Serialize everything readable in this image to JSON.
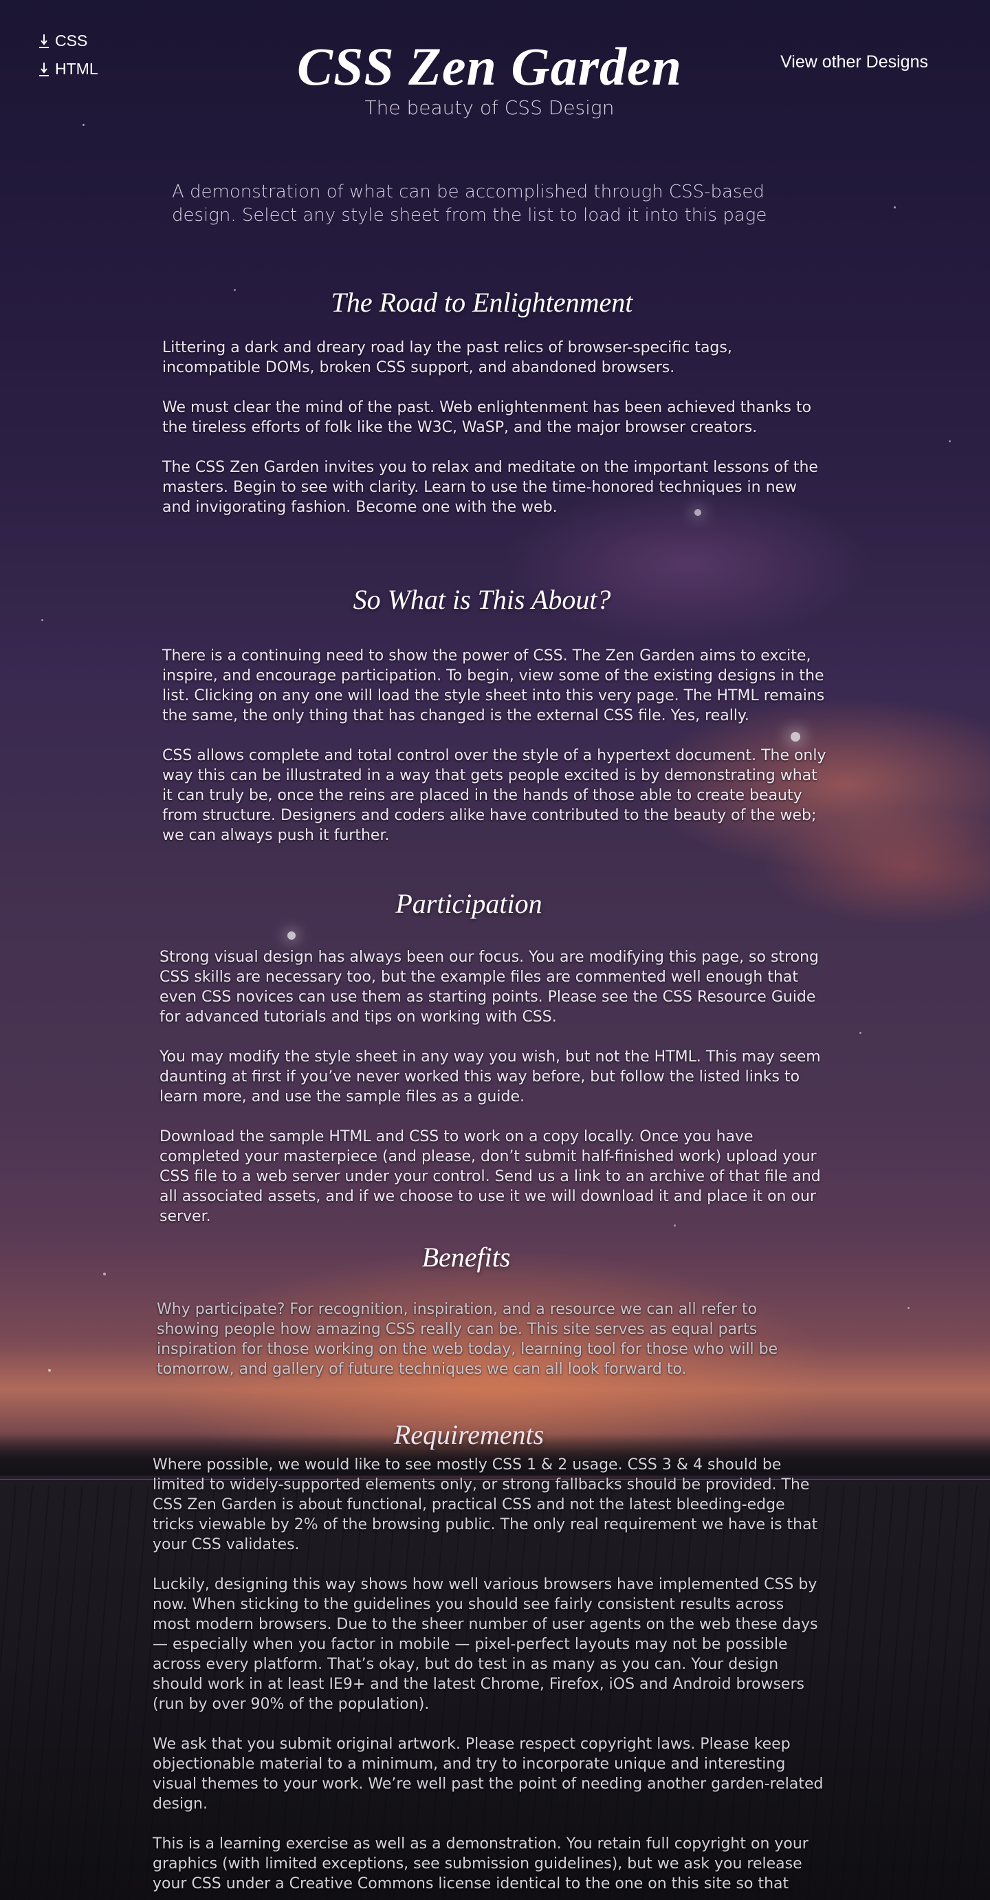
{
  "nav": {
    "css_label": "CSS",
    "html_label": "HTML",
    "view_other": "View other Designs"
  },
  "header": {
    "title": "CSS Zen Garden",
    "subtitle": "The beauty of CSS Design"
  },
  "summary": "A demonstration of what can be accomplished through CSS-based design.  Select any style sheet from the list to load it into this page",
  "sections": {
    "road": {
      "heading": "The Road to Enlightenment",
      "p1": "Littering a dark and dreary road lay the past relics of browser-specific tags, incompatible DOMs, broken CSS support, and abandoned browsers.",
      "p2": "We must clear the mind of the past. Web enlightenment has been achieved thanks to the tireless efforts of folk like the W3C, WaSP, and the major browser creators.",
      "p3": "The CSS Zen Garden invites you to relax and meditate on the important lessons of the masters. Begin to see with clarity. Learn to use the time-honored techniques in new and invigorating fashion. Become one with the web."
    },
    "about": {
      "heading": "So What is This About?",
      "p1": "There is a continuing need to show the power of CSS. The Zen Garden aims to excite, inspire, and encourage participation. To begin, view some of the existing designs in the list. Clicking on any one will load the style sheet into this very page. The HTML remains the same, the only thing that has changed is the external CSS file. Yes, really.",
      "p2": "CSS allows complete and total control over the style of a hypertext document. The only way this can be illustrated in a way that gets people excited is by demonstrating what it can truly be, once the reins are placed in the hands of those able to create beauty from structure. Designers and coders alike have contributed to the beauty of the web; we can always push it further."
    },
    "participation": {
      "heading": "Participation",
      "p1": "Strong visual design has always been our focus. You are modifying this page, so strong CSS skills are necessary too, but the example files are commented well enough that even CSS novices can use them as starting points. Please see the CSS Resource Guide for advanced tutorials and tips on working with CSS.",
      "p2": "You may modify the style sheet in any way you wish, but not the HTML. This may seem daunting at first if you’ve never worked this way before, but follow the listed links to learn more, and use the sample files as a guide.",
      "p3": "Download the sample HTML and CSS to work on a copy locally. Once you have completed your masterpiece (and please, don’t submit half-finished work) upload your CSS file to a web server under your control. Send us a link to an archive of that file and all associated assets, and if we choose to use it we will download it and place it on our server."
    },
    "benefits": {
      "heading": "Benefits",
      "p1": "Why participate? For recognition, inspiration, and a resource we can all refer to showing people how amazing CSS really can be. This site serves as equal parts inspiration for those working on the web today, learning tool for those who will be tomorrow, and gallery of future techniques we can all look forward to."
    },
    "requirements": {
      "heading": "Requirements",
      "p1": "Where possible, we would like to see mostly CSS 1 & 2 usage. CSS 3 & 4 should be limited to widely-supported elements only, or strong fallbacks should be provided. The CSS Zen Garden is about functional, practical CSS and not the latest bleeding-edge tricks viewable by 2% of the browsing public. The only real requirement we have is that your CSS validates.",
      "p2": "Luckily, designing this way shows how well various browsers have implemented CSS by now. When sticking to the guidelines you should see fairly consistent results across most modern browsers. Due to the sheer number of user agents on the web these days — especially when you factor in mobile — pixel-perfect layouts may not be possible across every platform. That’s okay, but do test in as many as you can. Your design should work in at least IE9+ and the latest Chrome, Firefox, iOS and Android browsers (run by over 90% of the population).",
      "p3": "We ask that you submit original artwork. Please respect copyright laws. Please keep objectionable material to a minimum, and try to incorporate unique and interesting visual themes to your work. We’re well past the point of needing another garden-related design.",
      "p4": "This is a learning exercise as well as a demonstration. You retain full copyright on your graphics (with limited exceptions, see submission guidelines), but we ask you release your CSS under a Creative Commons license identical to the one on this site so that"
    }
  },
  "icons": {
    "css_download": "download-icon",
    "html_download": "download-icon"
  }
}
